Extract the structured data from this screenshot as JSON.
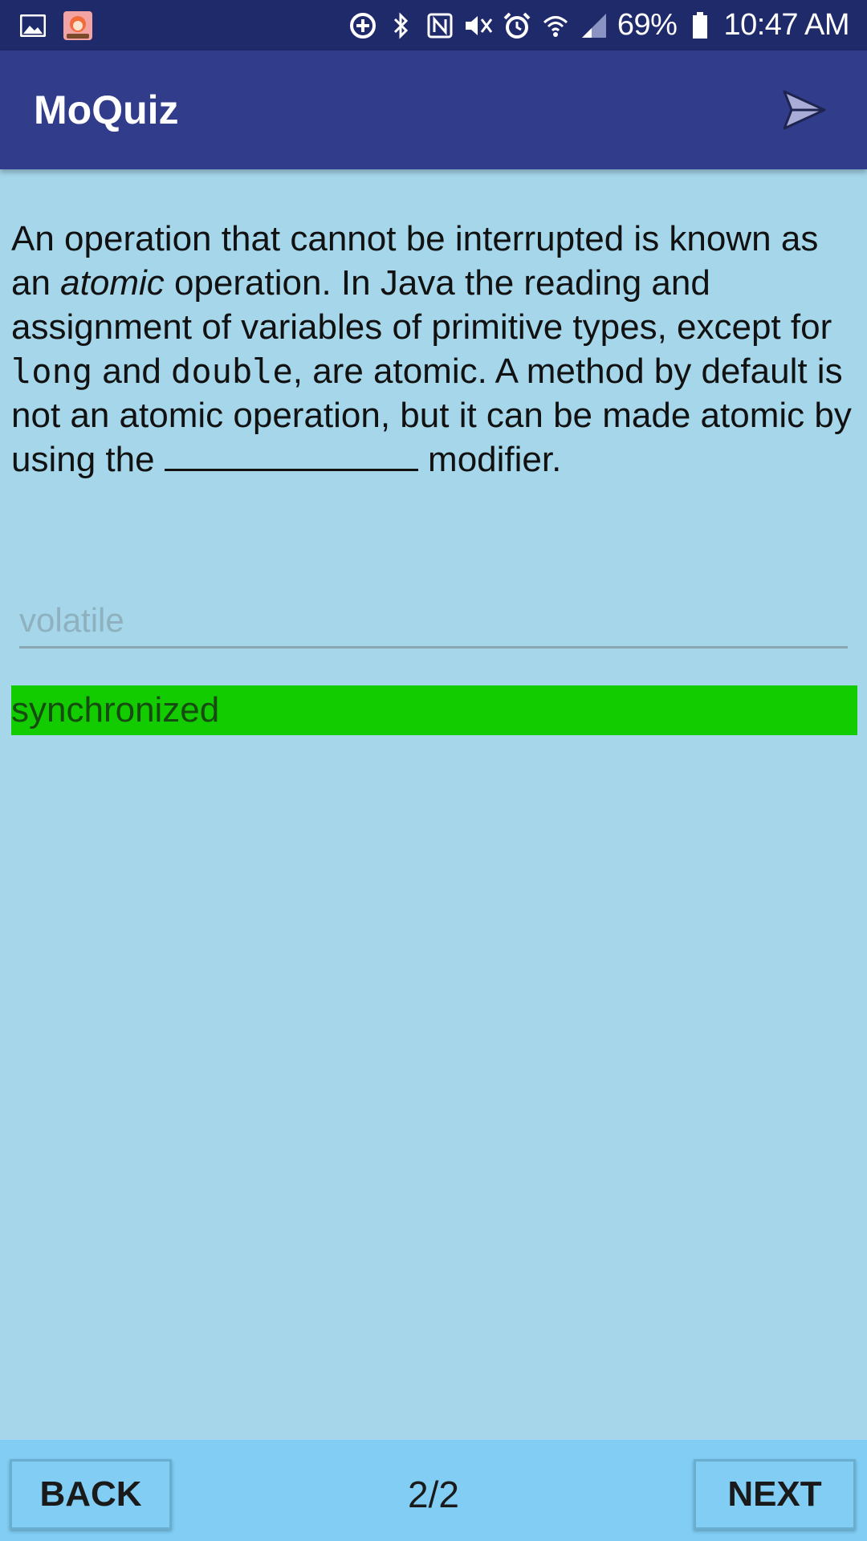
{
  "status_bar": {
    "battery": "69%",
    "time": "10:47 AM",
    "icons": [
      "gallery-icon",
      "game-app-icon",
      "data-saver-icon",
      "bluetooth-icon",
      "nfc-icon",
      "mute-icon",
      "alarm-icon",
      "wifi-icon",
      "signal-icon",
      "battery-icon"
    ]
  },
  "app_bar": {
    "title": "MoQuiz",
    "send_icon": "send-icon"
  },
  "question": {
    "part1": "An operation that cannot be interrupted is known as an ",
    "italic": "atomic",
    "part2": " operation. In Java the reading and assignment of variables of primitive types, except for ",
    "code1": "long",
    "part3": " and ",
    "code2": "double",
    "part4": ", are atomic. A method by default is not an atomic operation, but it can be made atomic by using the ",
    "part5": " modifier."
  },
  "answer": {
    "placeholder": "volatile",
    "value": ""
  },
  "correct_answer": {
    "text": "synchronized",
    "color": "#13cc00"
  },
  "navigation": {
    "back_label": "BACK",
    "next_label": "NEXT",
    "page": "2/2"
  },
  "colors": {
    "status_bar": "#1f2a6b",
    "app_bar": "#313d8b",
    "background": "#a5d6ea",
    "bottom_bar": "#81cdf4"
  }
}
